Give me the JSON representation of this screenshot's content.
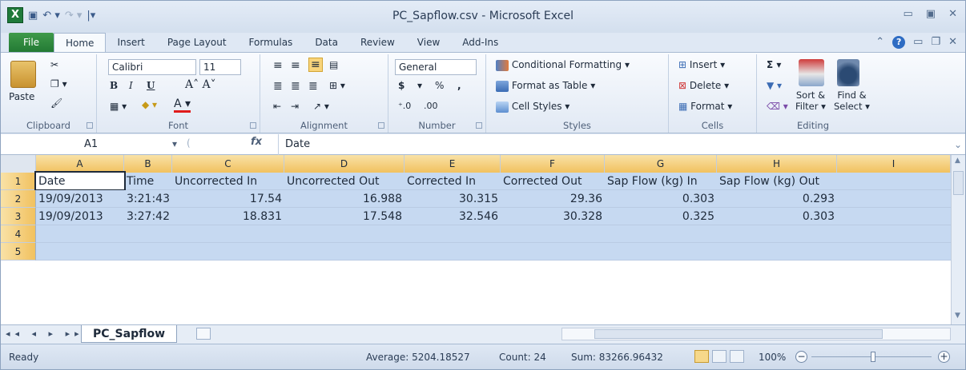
{
  "window": {
    "title": "PC_Sapflow.csv  -  Microsoft Excel"
  },
  "tabs": [
    "File",
    "Home",
    "Insert",
    "Page Layout",
    "Formulas",
    "Data",
    "Review",
    "View",
    "Add-Ins"
  ],
  "ribbon": {
    "clipboard": {
      "label": "Clipboard",
      "paste": "Paste"
    },
    "font": {
      "label": "Font",
      "name": "Calibri",
      "size": "11",
      "bold": "B",
      "italic": "I",
      "underline": "U"
    },
    "alignment": {
      "label": "Alignment"
    },
    "number": {
      "label": "Number",
      "format": "General",
      "currency": "$",
      "percent": "%",
      "comma": ","
    },
    "styles": {
      "label": "Styles",
      "conditional": "Conditional Formatting",
      "table": "Format as Table",
      "cell": "Cell Styles"
    },
    "cells": {
      "label": "Cells",
      "insert": "Insert",
      "delete": "Delete",
      "format": "Format"
    },
    "editing": {
      "label": "Editing",
      "sum": "Σ",
      "sort": "Sort &",
      "filter": "Filter",
      "find": "Find &",
      "select": "Select"
    }
  },
  "formula_bar": {
    "name_box": "A1",
    "fx": "fx",
    "value": "Date"
  },
  "columns": [
    "A",
    "B",
    "C",
    "D",
    "E",
    "F",
    "G",
    "H",
    "I"
  ],
  "rows": [
    {
      "num": "1",
      "cells": [
        "Date",
        "Time",
        "Uncorrected In",
        "Uncorrected Out",
        "Corrected In",
        "Corrected Out",
        "Sap Flow (kg) In",
        "Sap Flow (kg) Out",
        ""
      ]
    },
    {
      "num": "2",
      "cells": [
        "19/09/2013",
        "3:21:43",
        "17.54",
        "16.988",
        "30.315",
        "29.36",
        "0.303",
        "0.293",
        ""
      ]
    },
    {
      "num": "3",
      "cells": [
        "19/09/2013",
        "3:27:42",
        "18.831",
        "17.548",
        "32.546",
        "30.328",
        "0.325",
        "0.303",
        ""
      ]
    },
    {
      "num": "4",
      "cells": [
        "",
        "",
        "",
        "",
        "",
        "",
        "",
        "",
        ""
      ]
    },
    {
      "num": "5",
      "cells": [
        "",
        "",
        "",
        "",
        "",
        "",
        "",
        "",
        ""
      ]
    }
  ],
  "sheet": {
    "name": "PC_Sapflow"
  },
  "status": {
    "ready": "Ready",
    "average": "Average: 5204.18527",
    "count": "Count: 24",
    "sum": "Sum: 83266.96432",
    "zoom": "100%"
  },
  "colors": {
    "selection": "#c6d9f1",
    "header_selected": "#f1c15f",
    "file_tab": "#237a34"
  }
}
